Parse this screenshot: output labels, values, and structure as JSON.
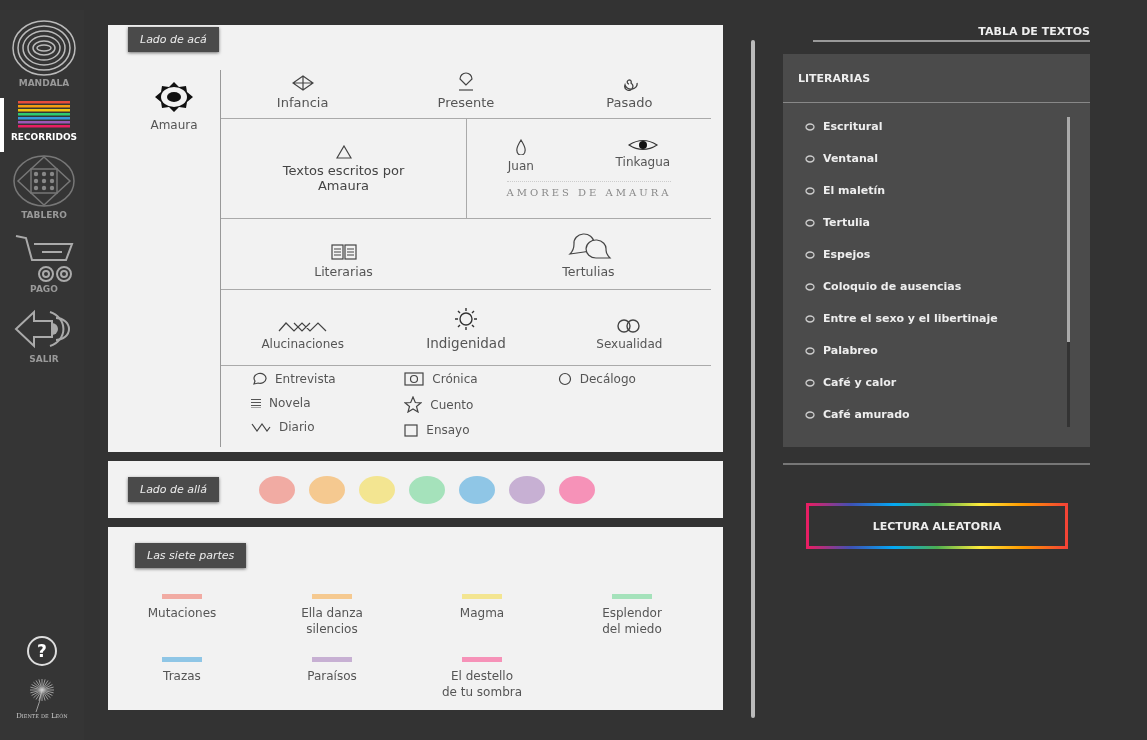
{
  "sidebar": {
    "items": [
      {
        "label": "MANDALA",
        "selected": false
      },
      {
        "label": "RECORRIDOS",
        "selected": true
      },
      {
        "label": "TABLERO",
        "selected": false
      },
      {
        "label": "PAGO",
        "selected": false
      },
      {
        "label": "SALIR",
        "selected": false
      }
    ],
    "help": "?",
    "logo": "Diente de León"
  },
  "lado_aca": {
    "tag": "Lado de acá",
    "author": "Amaura",
    "times": [
      "Infancia",
      "Presente",
      "Pasado"
    ],
    "own_texts": "Textos escritos por Amaura",
    "loves": [
      "Juan",
      "Tinkagua"
    ],
    "loves_caption": "AMORES DE AMAURA",
    "groups": [
      "Literarias",
      "Tertulias"
    ],
    "themes": [
      "Alucinaciones",
      "Indigenidad",
      "Sexualidad"
    ],
    "genres": [
      [
        "Entrevista",
        "Novela",
        "Diario"
      ],
      [
        "Crónica",
        "Cuento",
        "Ensayo"
      ],
      [
        "Decálogo"
      ]
    ]
  },
  "lado_alla": {
    "tag": "Lado de allá",
    "dots": [
      {
        "color": "#f1aba3"
      },
      {
        "color": "#f5c990"
      },
      {
        "color": "#f3e591"
      },
      {
        "color": "#a5e2bb"
      },
      {
        "color": "#8fc6e6"
      },
      {
        "color": "#c7b0d3"
      },
      {
        "color": "#f692b8"
      }
    ]
  },
  "siete_partes": {
    "tag": "Las siete partes",
    "parts": [
      {
        "label": "Mutaciones",
        "color": "#f1aba3"
      },
      {
        "label": "Ella danza\nsilencios",
        "color": "#f5c990"
      },
      {
        "label": "Magma",
        "color": "#f3e591"
      },
      {
        "label": "Esplendor\ndel miedo",
        "color": "#a5e2bb"
      },
      {
        "label": "Trazas",
        "color": "#8fc6e6"
      },
      {
        "label": "Paraísos",
        "color": "#c7b0d3"
      },
      {
        "label": "El destello\nde tu sombra",
        "color": "#f692b8"
      }
    ]
  },
  "tabla": {
    "title": "TABLA DE TEXTOS",
    "section": "LITERARIAS",
    "items": [
      "Escritural",
      "Ventanal",
      "El maletín",
      "Tertulia",
      "Espejos",
      "Coloquio de ausencias",
      "Entre el sexo y el libertinaje",
      "Palabreo",
      "Café y calor",
      "Café amurado"
    ],
    "button": "LECTURA ALEATORIA"
  }
}
